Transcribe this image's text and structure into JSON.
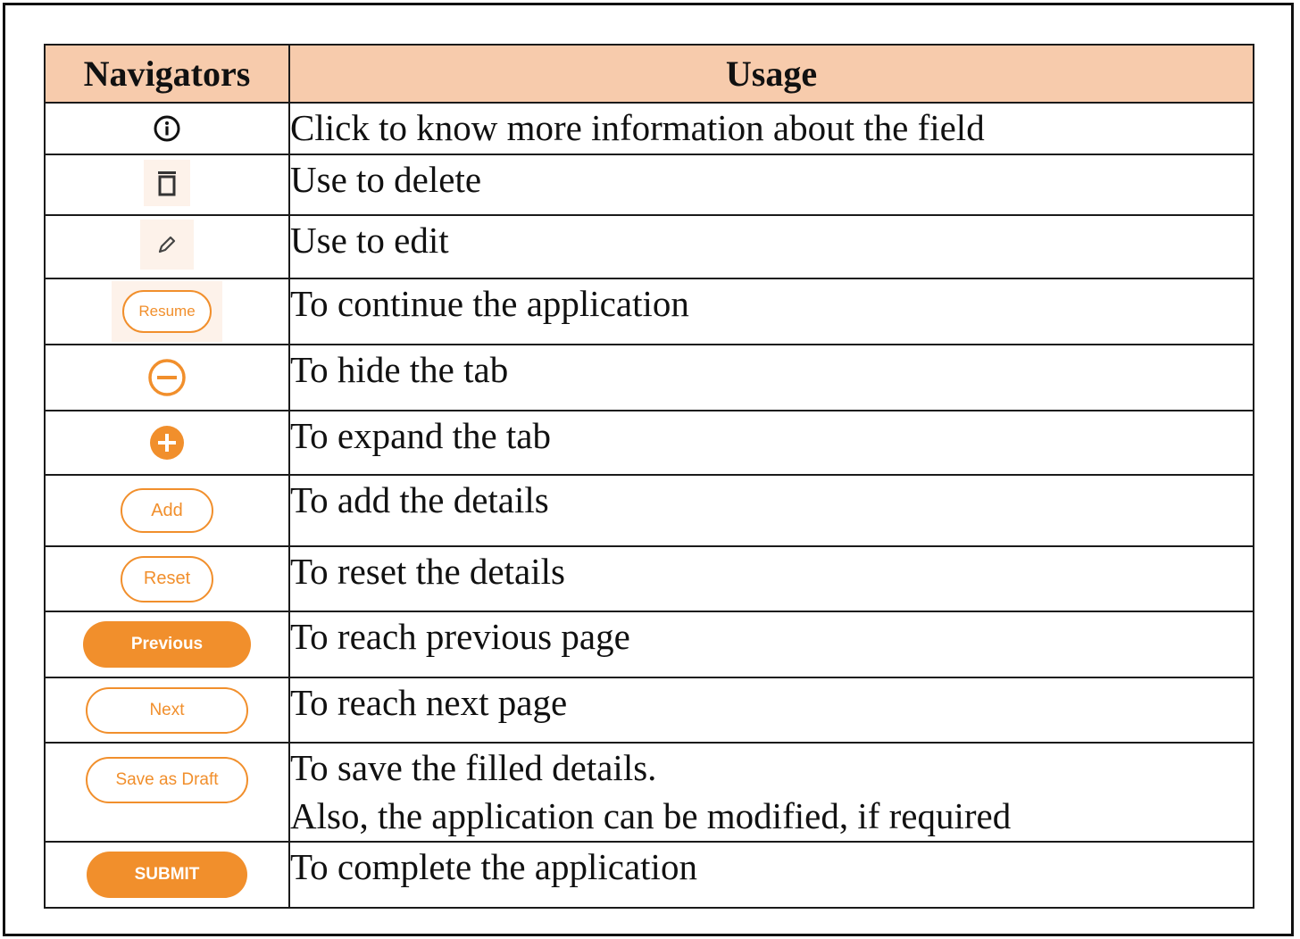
{
  "headers": {
    "navigators": "Navigators",
    "usage": "Usage"
  },
  "rows": [
    {
      "icon": "info-icon",
      "usage": "Click to know more information about the field"
    },
    {
      "icon": "trash-icon",
      "usage": "Use to delete"
    },
    {
      "icon": "pencil-icon",
      "usage": "Use to edit"
    },
    {
      "icon": "resume-button",
      "button_label": "Resume",
      "usage": "To continue the application"
    },
    {
      "icon": "minus-circle-icon",
      "usage": "To hide the tab"
    },
    {
      "icon": "plus-circle-icon",
      "usage": "To expand the tab"
    },
    {
      "icon": "add-button",
      "button_label": "Add",
      "usage": "To add the details"
    },
    {
      "icon": "reset-button",
      "button_label": "Reset",
      "usage": "To reset the details"
    },
    {
      "icon": "previous-button",
      "button_label": "Previous",
      "usage": "To reach previous page"
    },
    {
      "icon": "next-button",
      "button_label": "Next",
      "usage": "To reach next page"
    },
    {
      "icon": "save-as-draft-button",
      "button_label": "Save as Draft",
      "usage": "To save the filled details.",
      "usage_line2": "Also, the application can be modified, if required"
    },
    {
      "icon": "submit-button",
      "button_label": "SUBMIT",
      "usage": "To complete the application"
    }
  ],
  "colors": {
    "header_bg": "#f7cbac",
    "accent": "#f18f2c",
    "border": "#1a1a1a"
  }
}
